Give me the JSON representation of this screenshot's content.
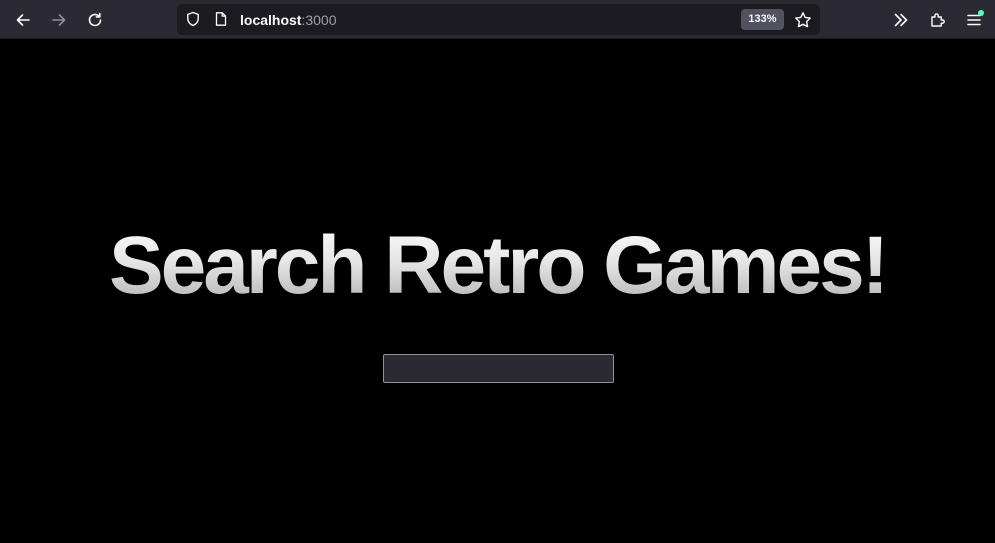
{
  "browser": {
    "url_host": "localhost",
    "url_port": ":3000",
    "zoom_level": "133%",
    "icons": {
      "back": "back-arrow-icon",
      "forward": "forward-arrow-icon",
      "reload": "reload-icon",
      "shield": "tracking-protection-shield-icon",
      "page": "page-icon",
      "bookmark": "star-icon",
      "overflow": "chevrons-right-icon",
      "extensions": "puzzle-piece-icon",
      "menu": "hamburger-menu-icon"
    },
    "colors": {
      "toolbar": "#2b2a33",
      "urlbar": "#1c1b22",
      "notification_dot": "#54ffbd"
    }
  },
  "page": {
    "title": "Search Retro Games!",
    "search": {
      "value": "",
      "placeholder": ""
    },
    "colors": {
      "background": "#000000",
      "title_gradient_top": "#ffffff",
      "title_gradient_bottom": "#a9a9a9"
    }
  }
}
